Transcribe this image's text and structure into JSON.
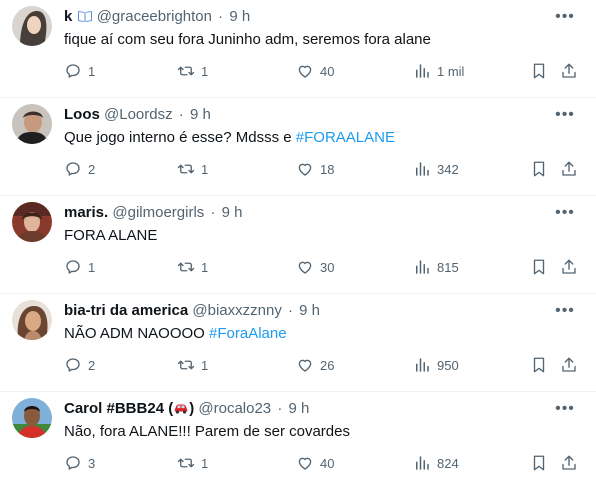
{
  "tweets": [
    {
      "name": "k",
      "name_emoji": "open-book-emoji",
      "handle": "@graceebrighton",
      "dot": "·",
      "time": "9 h",
      "text": "fique aí com seu fora Juninho adm, seremos fora alane",
      "hashtag": "",
      "replies": "1",
      "retweets": "1",
      "likes": "40",
      "views": "1 mil"
    },
    {
      "name": "Loos",
      "handle": "@Loordsz",
      "dot": "·",
      "time": "9 h",
      "text": "Que jogo interno é esse? Mdsss e ",
      "hashtag": "#FORAALANE",
      "replies": "2",
      "retweets": "1",
      "likes": "18",
      "views": "342"
    },
    {
      "name": "maris.",
      "handle": "@gilmoergirls",
      "dot": "·",
      "time": "9 h",
      "text": "FORA ALANE",
      "hashtag": "",
      "replies": "1",
      "retweets": "1",
      "likes": "30",
      "views": "815"
    },
    {
      "name": "bia-tri da america",
      "handle": "@biaxxzznny",
      "dot": "·",
      "time": "9 h",
      "text": "NÃO ADM NAOOOO ",
      "hashtag": "#ForaAlane",
      "replies": "2",
      "retweets": "1",
      "likes": "26",
      "views": "950"
    },
    {
      "name": "Carol #BBB24 (",
      "name_emoji": "red-car-emoji",
      "name_suffix": ")",
      "handle": "@rocalo23",
      "dot": "·",
      "time": "9 h",
      "text": "Não, fora ALANE!!! Parem de ser covardes",
      "hashtag": "",
      "replies": "3",
      "retweets": "1",
      "likes": "40",
      "views": "824"
    }
  ],
  "icons": {
    "more": "more-horizontal-icon",
    "reply": "reply-bubble-icon",
    "retweet": "retweet-icon",
    "like": "heart-icon",
    "views": "bar-chart-icon",
    "bookmark": "bookmark-icon",
    "share": "share-upload-icon"
  },
  "colors": {
    "text": "#0f1419",
    "secondary": "#536471",
    "link": "#1d9bf0",
    "divider": "#eff3f4"
  }
}
